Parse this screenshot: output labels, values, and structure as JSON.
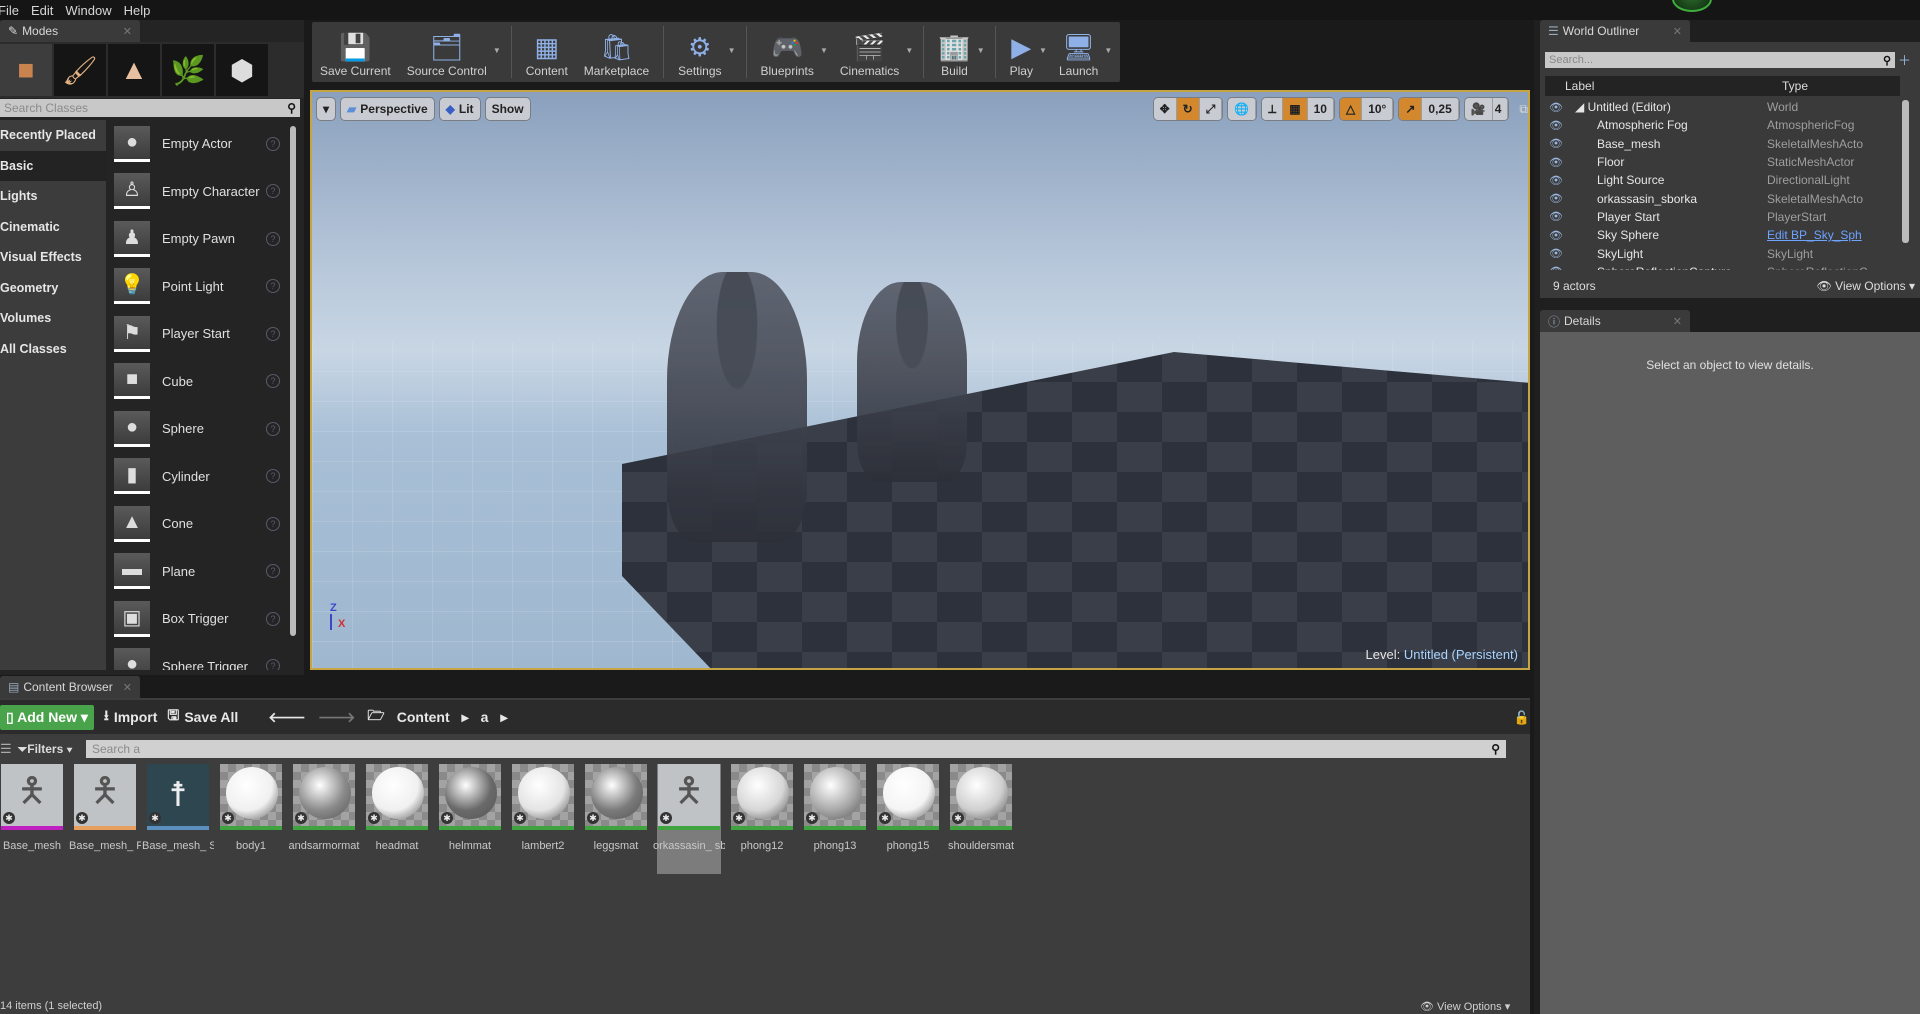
{
  "menu": [
    "File",
    "Edit",
    "Window",
    "Help"
  ],
  "modes_panel": {
    "tab_label": "Modes",
    "mode_icons": [
      "place-mode-icon",
      "paint-mode-icon",
      "landscape-mode-icon",
      "foliage-mode-icon",
      "geometry-mode-icon"
    ],
    "search_placeholder": "Search Classes",
    "categories": [
      "Recently Placed",
      "Basic",
      "Lights",
      "Cinematic",
      "Visual Effects",
      "Geometry",
      "Volumes",
      "All Classes"
    ],
    "active_category": "Basic",
    "items": [
      {
        "label": "Empty Actor",
        "icon": "●"
      },
      {
        "label": "Empty Character",
        "icon": "♙"
      },
      {
        "label": "Empty Pawn",
        "icon": "♟"
      },
      {
        "label": "Point Light",
        "icon": "💡"
      },
      {
        "label": "Player Start",
        "icon": "⚑"
      },
      {
        "label": "Cube",
        "icon": "■"
      },
      {
        "label": "Sphere",
        "icon": "●"
      },
      {
        "label": "Cylinder",
        "icon": "▮"
      },
      {
        "label": "Cone",
        "icon": "▲"
      },
      {
        "label": "Plane",
        "icon": "▬"
      },
      {
        "label": "Box Trigger",
        "icon": "▣"
      },
      {
        "label": "Sphere Trigger",
        "icon": "●"
      }
    ]
  },
  "toolbar": {
    "buttons": [
      {
        "label": "Save Current",
        "icon": "💾",
        "dropdown": false
      },
      {
        "label": "Source Control",
        "icon": "🗂",
        "dropdown": true
      },
      {
        "label": "Content",
        "icon": "▦",
        "dropdown": false
      },
      {
        "label": "Marketplace",
        "icon": "🛍",
        "dropdown": false
      },
      {
        "label": "Settings",
        "icon": "⚙",
        "dropdown": true
      },
      {
        "label": "Blueprints",
        "icon": "🎮",
        "dropdown": true
      },
      {
        "label": "Cinematics",
        "icon": "🎬",
        "dropdown": true
      },
      {
        "label": "Build",
        "icon": "🏢",
        "dropdown": true
      },
      {
        "label": "Play",
        "icon": "▶",
        "dropdown": true
      },
      {
        "label": "Launch",
        "icon": "🖥",
        "dropdown": true
      }
    ]
  },
  "viewport": {
    "view_mode": "Perspective",
    "lighting": "Lit",
    "show": "Show",
    "grid_snap": "10",
    "rotation_snap": "10°",
    "scale_snap": "0,25",
    "camera_speed": "4",
    "level_label": "Level:",
    "level_name": "Untitled (Persistent)",
    "axes": {
      "z": "Z",
      "x": "X"
    }
  },
  "content_browser": {
    "tab_label": "Content Browser",
    "add_new": "Add New",
    "import": "Import",
    "save_all": "Save All",
    "breadcrumb": [
      "Content",
      "a"
    ],
    "filters": "Filters",
    "search_placeholder": "Search a",
    "assets": [
      {
        "name": "Base_mesh",
        "kind": "mesh",
        "bar": "#c020c0"
      },
      {
        "name": "Base_mesh_ PhysicsAsset",
        "kind": "mesh",
        "bar": "#e8a060"
      },
      {
        "name": "Base_mesh_ Skeleton",
        "kind": "skeleton",
        "bar": "#5a8fbf"
      },
      {
        "name": "body1",
        "kind": "material",
        "tone": "#f0f0f0",
        "bar": "#3fa33f"
      },
      {
        "name": "andsarmormat",
        "kind": "material",
        "tone": "#8a8a8a",
        "bar": "#3fa33f"
      },
      {
        "name": "headmat",
        "kind": "material",
        "tone": "#f0f0f0",
        "bar": "#3fa33f"
      },
      {
        "name": "helmmat",
        "kind": "material",
        "tone": "#6a6a6a",
        "bar": "#3fa33f"
      },
      {
        "name": "lambert2",
        "kind": "material",
        "tone": "#e4e4e4",
        "bar": "#3fa33f"
      },
      {
        "name": "leggsmat",
        "kind": "material",
        "tone": "#7a7a7a",
        "bar": "#3fa33f"
      },
      {
        "name": "orkassasin_ sborka",
        "kind": "mesh",
        "bar": "#3fa33f",
        "selected": true
      },
      {
        "name": "phong12",
        "kind": "material",
        "tone": "#d6d6d6",
        "bar": "#3fa33f"
      },
      {
        "name": "phong13",
        "kind": "material",
        "tone": "#a8a8a8",
        "bar": "#3fa33f"
      },
      {
        "name": "phong15",
        "kind": "material",
        "tone": "#f4f4f4",
        "bar": "#3fa33f"
      },
      {
        "name": "shouldersmat",
        "kind": "material",
        "tone": "#cfcfcf",
        "bar": "#3fa33f"
      }
    ],
    "status": "14 items (1 selected)",
    "view_options": "View Options"
  },
  "world_outliner": {
    "tab_label": "World Outliner",
    "search_placeholder": "Search...",
    "col_label": "Label",
    "col_type": "Type",
    "rows": [
      {
        "label": "Untitled (Editor)",
        "type": "World",
        "root": true
      },
      {
        "label": "Atmospheric Fog",
        "type": "AtmosphericFog"
      },
      {
        "label": "Base_mesh",
        "type": "SkeletalMeshActo"
      },
      {
        "label": "Floor",
        "type": "StaticMeshActor"
      },
      {
        "label": "Light Source",
        "type": "DirectionalLight"
      },
      {
        "label": "orkassasin_sborka",
        "type": "SkeletalMeshActo"
      },
      {
        "label": "Player Start",
        "type": "PlayerStart"
      },
      {
        "label": "Sky Sphere",
        "type": "Edit BP_Sky_Sph",
        "link": true
      },
      {
        "label": "SkyLight",
        "type": "SkyLight"
      },
      {
        "label": "SphereReflectionCapture",
        "type": "SphereReflectionC"
      }
    ],
    "count": "9 actors",
    "view_options": "View Options"
  },
  "details": {
    "tab_label": "Details",
    "empty_message": "Select an object to view details."
  }
}
